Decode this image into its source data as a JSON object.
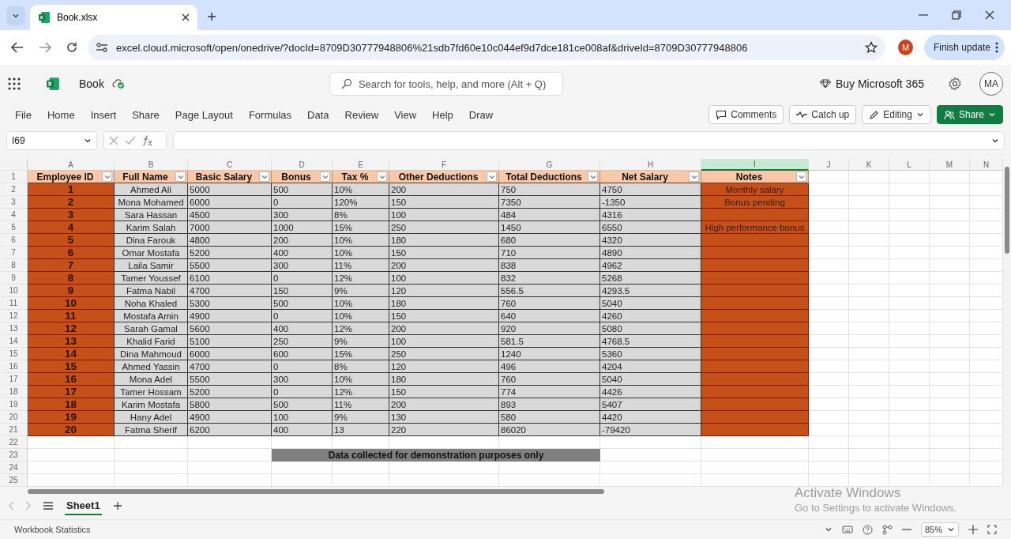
{
  "browser": {
    "tabs": [
      {
        "title": "Book.xlsx",
        "selected": true
      }
    ],
    "url": "excel.cloud.microsoft/open/onedrive/?docId=8709D30777948806%21sdb7fd60e10c044ef9d7dce181ce008af&driveId=8709D30777948806",
    "profile_initial": "M",
    "update_button": "Finish update"
  },
  "app": {
    "file_name": "Book",
    "search": {
      "placeholder": "Search for tools, help, and more (Alt + Q)"
    },
    "buy_link": "Buy Microsoft 365",
    "avatar": "MA",
    "menu": [
      {
        "label": "File"
      },
      {
        "label": "Home"
      },
      {
        "label": "Insert"
      },
      {
        "label": "Share"
      },
      {
        "label": "Page Layout"
      },
      {
        "label": "Formulas"
      },
      {
        "label": "Data"
      },
      {
        "label": "Review"
      },
      {
        "label": "View"
      },
      {
        "label": "Help"
      },
      {
        "label": "Draw"
      }
    ],
    "actions": [
      {
        "label": "Comments",
        "kind": "comments"
      },
      {
        "label": "Catch up",
        "kind": "catchup"
      },
      {
        "label": "Editing",
        "kind": "editing"
      },
      {
        "label": "Share",
        "kind": "share"
      }
    ]
  },
  "formula_bar": {
    "name_box": "I69"
  },
  "sheet": {
    "columns": [
      {
        "letter": "A",
        "selected": false
      },
      {
        "letter": "B",
        "selected": false
      },
      {
        "letter": "C",
        "selected": false
      },
      {
        "letter": "D",
        "selected": false
      },
      {
        "letter": "E",
        "selected": false
      },
      {
        "letter": "F",
        "selected": false
      },
      {
        "letter": "G",
        "selected": false
      },
      {
        "letter": "H",
        "selected": false
      },
      {
        "letter": "I",
        "selected": true
      },
      {
        "letter": "J",
        "selected": false
      },
      {
        "letter": "K",
        "selected": false
      },
      {
        "letter": "L",
        "selected": false
      },
      {
        "letter": "M",
        "selected": false
      },
      {
        "letter": "N",
        "selected": false
      }
    ],
    "row_numbers": [
      "1",
      "2",
      "3",
      "4",
      "5",
      "6",
      "7",
      "8",
      "9",
      "10",
      "11",
      "12",
      "13",
      "14",
      "15",
      "16",
      "17",
      "18",
      "19",
      "20",
      "21",
      "22",
      "23",
      "24",
      "25"
    ],
    "headers": [
      "Employee ID",
      "Full Name",
      "Basic Salary",
      "Bonus",
      "Tax %",
      "Other Deductions",
      "Total Deductions",
      "Net Salary",
      "Notes"
    ],
    "rows": [
      {
        "cells": [
          "1",
          "Ahmed Ali",
          "5000",
          "500",
          "10%",
          "200",
          "750",
          "4750"
        ],
        "note": "Monthly salary"
      },
      {
        "cells": [
          "2",
          "Mona Mohamed",
          "6000",
          "0",
          "120%",
          "150",
          "7350",
          "-1350"
        ],
        "note": "Bonus pending"
      },
      {
        "cells": [
          "3",
          "Sara Hassan",
          "4500",
          "300",
          "8%",
          "100",
          "484",
          "4316"
        ]
      },
      {
        "cells": [
          "4",
          "Karim Salah",
          "7000",
          "1000",
          "15%",
          "250",
          "1450",
          "6550"
        ],
        "note": "High performance bonus"
      },
      {
        "cells": [
          "5",
          "Dina Farouk",
          "4800",
          "200",
          "10%",
          "180",
          "680",
          "4320"
        ]
      },
      {
        "cells": [
          "6",
          "Omar Mostafa",
          "5200",
          "400",
          "10%",
          "150",
          "710",
          "4890"
        ]
      },
      {
        "cells": [
          "7",
          "Laila Samir",
          "5500",
          "300",
          "11%",
          "200",
          "838",
          "4962"
        ]
      },
      {
        "cells": [
          "8",
          "Tamer Youssef",
          "6100",
          "0",
          "12%",
          "100",
          "832",
          "5268"
        ]
      },
      {
        "cells": [
          "9",
          "Fatma Nabil",
          "4700",
          "150",
          "9%",
          "120",
          "556.5",
          "4293.5"
        ]
      },
      {
        "cells": [
          "10",
          "Noha Khaled",
          "5300",
          "500",
          "10%",
          "180",
          "760",
          "5040"
        ]
      },
      {
        "cells": [
          "11",
          "Mostafa Amin",
          "4900",
          "0",
          "10%",
          "150",
          "640",
          "4260"
        ]
      },
      {
        "cells": [
          "12",
          "Sarah Gamal",
          "5600",
          "400",
          "12%",
          "200",
          "920",
          "5080"
        ]
      },
      {
        "cells": [
          "13",
          "Khalid Farid",
          "5100",
          "250",
          "9%",
          "100",
          "581.5",
          "4768.5"
        ]
      },
      {
        "cells": [
          "14",
          "Dina Mahmoud",
          "6000",
          "600",
          "15%",
          "250",
          "1240",
          "5360"
        ]
      },
      {
        "cells": [
          "15",
          "Ahmed Yassin",
          "4700",
          "0",
          "8%",
          "120",
          "496",
          "4204"
        ]
      },
      {
        "cells": [
          "16",
          "Mona Adel",
          "5500",
          "300",
          "10%",
          "180",
          "760",
          "5040"
        ]
      },
      {
        "cells": [
          "17",
          "Tamer Hossam",
          "5200",
          "0",
          "12%",
          "150",
          "774",
          "4426"
        ]
      },
      {
        "cells": [
          "18",
          "Karim Mostafa",
          "5800",
          "500",
          "11%",
          "200",
          "893",
          "5407"
        ]
      },
      {
        "cells": [
          "19",
          "Hany Adel",
          "4900",
          "100",
          "9%",
          "130",
          "580",
          "4420"
        ]
      },
      {
        "cells": [
          "20",
          "Fatma Sherif",
          "6200",
          "400",
          "13",
          "220",
          "86020",
          "-79420"
        ]
      }
    ],
    "banner": "Data collected for demonstration purposes only"
  },
  "sheet_tabs": [
    {
      "label": "Sheet1",
      "selected": true
    }
  ],
  "status_bar": {
    "label": "Workbook Statistics",
    "zoom": "85%"
  },
  "activation": {
    "title": "Activate Windows",
    "subtitle": "Go to Settings to activate Windows."
  }
}
